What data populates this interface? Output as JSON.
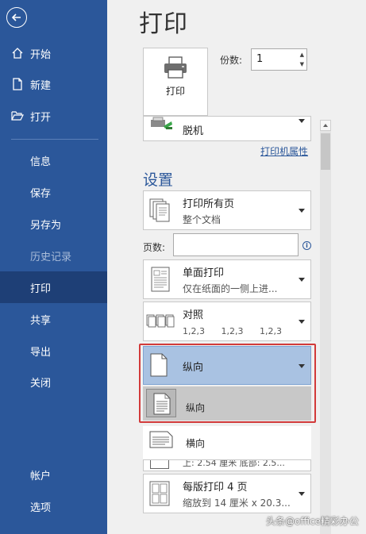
{
  "sidebar": {
    "items": [
      {
        "label": "开始"
      },
      {
        "label": "新建"
      },
      {
        "label": "打开"
      },
      {
        "label": "信息"
      },
      {
        "label": "保存"
      },
      {
        "label": "另存为"
      },
      {
        "label": "历史记录",
        "state": "disabled"
      },
      {
        "label": "打印",
        "state": "active"
      },
      {
        "label": "共享"
      },
      {
        "label": "导出"
      },
      {
        "label": "关闭"
      },
      {
        "label": "帐户"
      },
      {
        "label": "选项"
      }
    ],
    "icons": {
      "back": "back-arrow-icon",
      "home": "home-icon",
      "new": "new-document-icon",
      "open": "open-folder-icon"
    },
    "color": "#2b579a",
    "active_color": "#1e3f76"
  },
  "main": {
    "title": "打印",
    "print_button": {
      "label": "打印",
      "icon": "printer-icon"
    },
    "copies": {
      "label": "份数:",
      "value": "1"
    },
    "printer": {
      "status": "脱机",
      "properties_link": "打印机属性"
    },
    "settings": {
      "title": "设置",
      "print_range": {
        "title": "打印所有页",
        "subtitle": "整个文档"
      },
      "pages": {
        "label": "页数:",
        "value": "",
        "info_icon": "i"
      },
      "sides": {
        "title": "单面打印",
        "subtitle": "仅在纸面的一侧上进..."
      },
      "collate": {
        "title": "对照",
        "items": [
          "1,2,3",
          "1,2,3",
          "1,2,3"
        ]
      },
      "orientation": {
        "selected": "纵向",
        "options": [
          {
            "label": "纵向"
          },
          {
            "label": "横向"
          }
        ]
      },
      "margins_partial": "上: 2.54 厘米 底部: 2.5...",
      "pages_per_sheet": {
        "title": "每版打印 4 页",
        "subtitle": "缩放到 14 厘米 x 20.3..."
      }
    },
    "highlight_color": "#d23a3a"
  },
  "watermark": "头条@office精彩办公"
}
